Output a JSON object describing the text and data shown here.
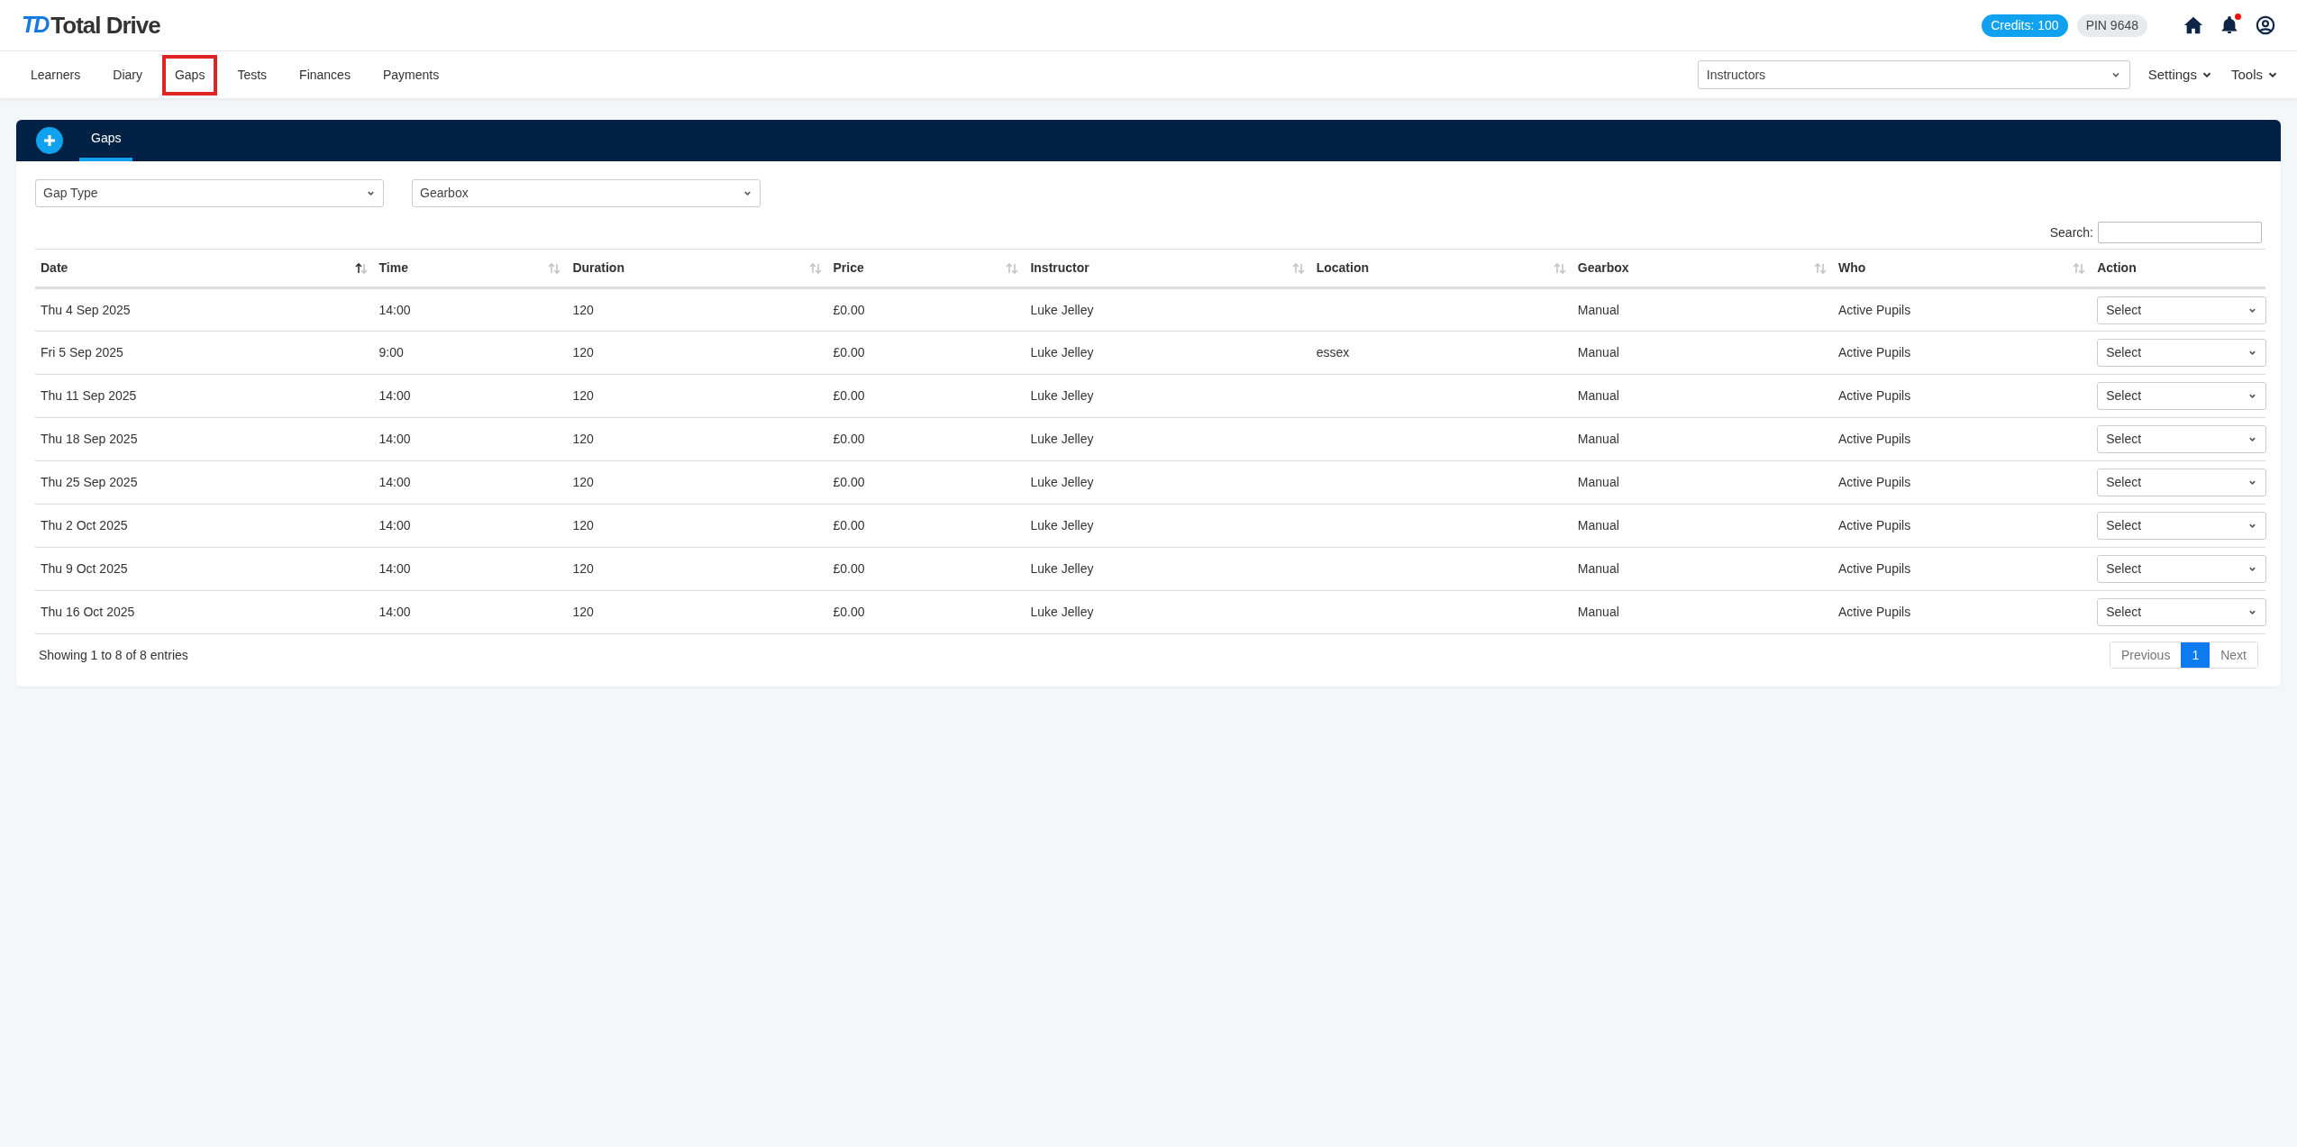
{
  "header": {
    "logo_mark": "TD",
    "logo_text": "Total Drive",
    "credits": "Credits: 100",
    "pin": "PIN 9648",
    "notification_dot": true
  },
  "nav": {
    "items": [
      {
        "label": "Learners",
        "selected": false
      },
      {
        "label": "Diary",
        "selected": false
      },
      {
        "label": "Gaps",
        "selected": true
      },
      {
        "label": "Tests",
        "selected": false
      },
      {
        "label": "Finances",
        "selected": false
      },
      {
        "label": "Payments",
        "selected": false
      }
    ],
    "instructor_select": "Instructors",
    "menus": [
      "Settings",
      "Tools"
    ]
  },
  "panel": {
    "tabs": [
      {
        "label": "Gaps",
        "selected": true
      }
    ],
    "filters": [
      "Gap Type",
      "Gearbox"
    ],
    "search_label": "Search:",
    "table": {
      "columns": [
        {
          "label": "Date",
          "sorted": true
        },
        {
          "label": "Time",
          "sorted": false
        },
        {
          "label": "Duration",
          "sorted": false
        },
        {
          "label": "Price",
          "sorted": false
        },
        {
          "label": "Instructor",
          "sorted": false
        },
        {
          "label": "Location",
          "sorted": false
        },
        {
          "label": "Gearbox",
          "sorted": false
        },
        {
          "label": "Who",
          "sorted": false
        },
        {
          "label": "Action"
        }
      ],
      "rows": [
        [
          "Thu 4 Sep 2025",
          "14:00",
          "120",
          "£0.00",
          "Luke Jelley",
          "",
          "Manual",
          "Active Pupils",
          "Select"
        ],
        [
          "Fri 5 Sep 2025",
          "9:00",
          "120",
          "£0.00",
          "Luke Jelley",
          "essex",
          "Manual",
          "Active Pupils",
          "Select"
        ],
        [
          "Thu 11 Sep 2025",
          "14:00",
          "120",
          "£0.00",
          "Luke Jelley",
          "",
          "Manual",
          "Active Pupils",
          "Select"
        ],
        [
          "Thu 18 Sep 2025",
          "14:00",
          "120",
          "£0.00",
          "Luke Jelley",
          "",
          "Manual",
          "Active Pupils",
          "Select"
        ],
        [
          "Thu 25 Sep 2025",
          "14:00",
          "120",
          "£0.00",
          "Luke Jelley",
          "",
          "Manual",
          "Active Pupils",
          "Select"
        ],
        [
          "Thu 2 Oct 2025",
          "14:00",
          "120",
          "£0.00",
          "Luke Jelley",
          "",
          "Manual",
          "Active Pupils",
          "Select"
        ],
        [
          "Thu 9 Oct 2025",
          "14:00",
          "120",
          "£0.00",
          "Luke Jelley",
          "",
          "Manual",
          "Active Pupils",
          "Select"
        ],
        [
          "Thu 16 Oct 2025",
          "14:00",
          "120",
          "£0.00",
          "Luke Jelley",
          "",
          "Manual",
          "Active Pupils",
          "Select"
        ]
      ]
    },
    "info": "Showing 1 to 8 of 8 entries",
    "pagination": [
      {
        "label": "Previous",
        "selected": false
      },
      {
        "label": "1",
        "selected": true
      },
      {
        "label": "Next",
        "selected": false
      }
    ]
  }
}
